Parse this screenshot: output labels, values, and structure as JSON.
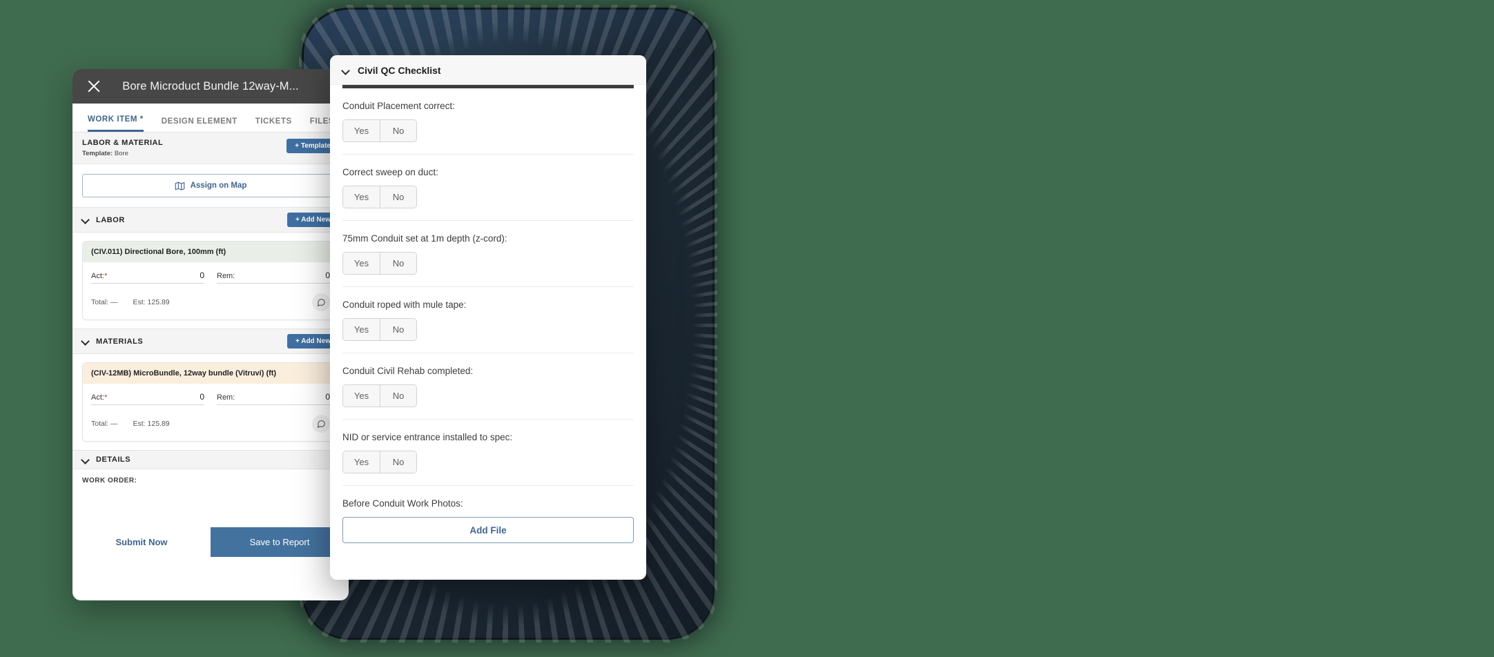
{
  "theme": {
    "page_background": "#3f6b4e",
    "phone_frame": "#1b2732",
    "accent_blue": "#3f6591",
    "button_blue": "#3f6fa3",
    "save_button_blue": "#43729e",
    "header_dark": "#474747",
    "labor_item_green": "#e9efe7",
    "material_item_orange": "#fbeedd"
  },
  "work_item_panel": {
    "header": {
      "close_icon": "close-icon",
      "title": "Bore Microduct Bundle 12way-M..."
    },
    "tabs": [
      {
        "label": "WORK ITEM *",
        "active": true
      },
      {
        "label": "DESIGN ELEMENT",
        "active": false
      },
      {
        "label": "TICKETS",
        "active": false
      },
      {
        "label": "FILES",
        "active": false
      }
    ],
    "labor_material": {
      "title": "LABOR & MATERIAL",
      "template_line_prefix": "Template:",
      "template_name": "Bore",
      "template_button": "+ Template"
    },
    "assign_on_map": {
      "label": "Assign on Map",
      "icon": "map-icon"
    },
    "labor_section": {
      "title": "LABOR",
      "add_new_button": "+ Add New",
      "chevron_icon": "chevron-down-icon",
      "items": [
        {
          "name": "(CIV.011) Directional Bore, 100mm (ft)",
          "act_label": "Act:",
          "act_required": "*",
          "act_value": "0",
          "rem_label": "Rem:",
          "rem_value": "0",
          "total_label": "Total: —",
          "est_label": "Est: 125.89",
          "comment_icon": "comment-icon"
        }
      ]
    },
    "materials_section": {
      "title": "MATERIALS",
      "add_new_button": "+ Add New",
      "chevron_icon": "chevron-down-icon",
      "items": [
        {
          "name": "(CIV-12MB) MicroBundle, 12way bundle (Vitruvi) (ft)",
          "act_label": "Act:",
          "act_required": "*",
          "act_value": "0",
          "rem_label": "Rem:",
          "rem_value": "0",
          "total_label": "Total: —",
          "est_label": "Est: 125.89",
          "comment_icon": "comment-icon"
        }
      ]
    },
    "details_section": {
      "title": "DETAILS",
      "chevron_icon": "chevron-down-icon",
      "work_order_label": "WORK ORDER:"
    },
    "actions": {
      "submit_now": "Submit Now",
      "save_to_report": "Save to Report"
    }
  },
  "qc_panel": {
    "header": {
      "title": "Civil QC Checklist",
      "chevron_icon": "chevron-down-icon"
    },
    "yes_label": "Yes",
    "no_label": "No",
    "questions": [
      {
        "label": "Conduit Placement correct:"
      },
      {
        "label": "Correct sweep on duct:"
      },
      {
        "label": "75mm Conduit set at 1m depth (z-cord):"
      },
      {
        "label": "Conduit roped with mule tape:"
      },
      {
        "label": "Conduit Civil Rehab completed:"
      },
      {
        "label": "NID or service entrance installed to spec:"
      }
    ],
    "file_upload": {
      "label": "Before Conduit Work Photos:",
      "button": "Add File"
    }
  }
}
